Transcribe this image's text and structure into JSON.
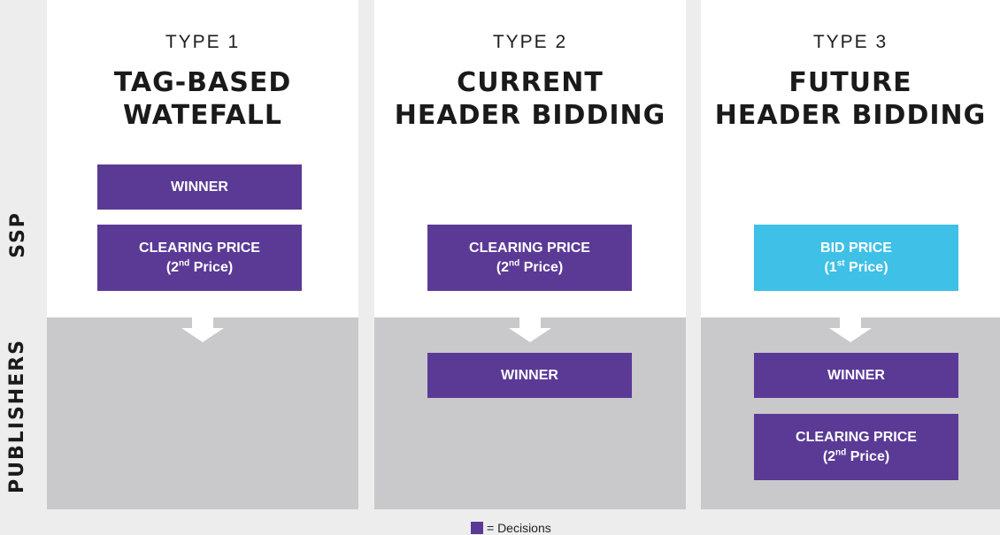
{
  "rows": {
    "top": "SSP",
    "bottom": "PUBLISHERS"
  },
  "columns": [
    {
      "type_label": "TYPE 1",
      "title_line1": "TAG-BASED",
      "title_line2": "WATEFALL",
      "ssp_boxes": [
        {
          "line1": "WINNER"
        },
        {
          "line1": "CLEARING PRICE",
          "open": "(2",
          "sup": "nd",
          "rest": " Price)"
        }
      ],
      "publisher_boxes": []
    },
    {
      "type_label": "TYPE 2",
      "title_line1": "CURRENT",
      "title_line2": "HEADER BIDDING",
      "ssp_boxes": [
        {
          "line1": "CLEARING PRICE",
          "open": "(2",
          "sup": "nd",
          "rest": " Price)"
        }
      ],
      "publisher_boxes": [
        {
          "line1": "WINNER"
        }
      ]
    },
    {
      "type_label": "TYPE 3",
      "title_line1": "FUTURE",
      "title_line2": "HEADER BIDDING",
      "ssp_boxes": [
        {
          "line1": "BID PRICE",
          "open": "(1",
          "sup": "st",
          "rest": " Price)"
        }
      ],
      "publisher_boxes": [
        {
          "line1": "WINNER"
        },
        {
          "line1": "CLEARING PRICE",
          "open": "(2",
          "sup": "nd",
          "rest": " Price)"
        }
      ]
    }
  ],
  "legend": {
    "label": "= Decisions"
  },
  "colors": {
    "decision": "#5b3a96",
    "bid": "#3fc0e6",
    "ssp_bg": "#ffffff",
    "publisher_bg": "#c9c9cb"
  }
}
